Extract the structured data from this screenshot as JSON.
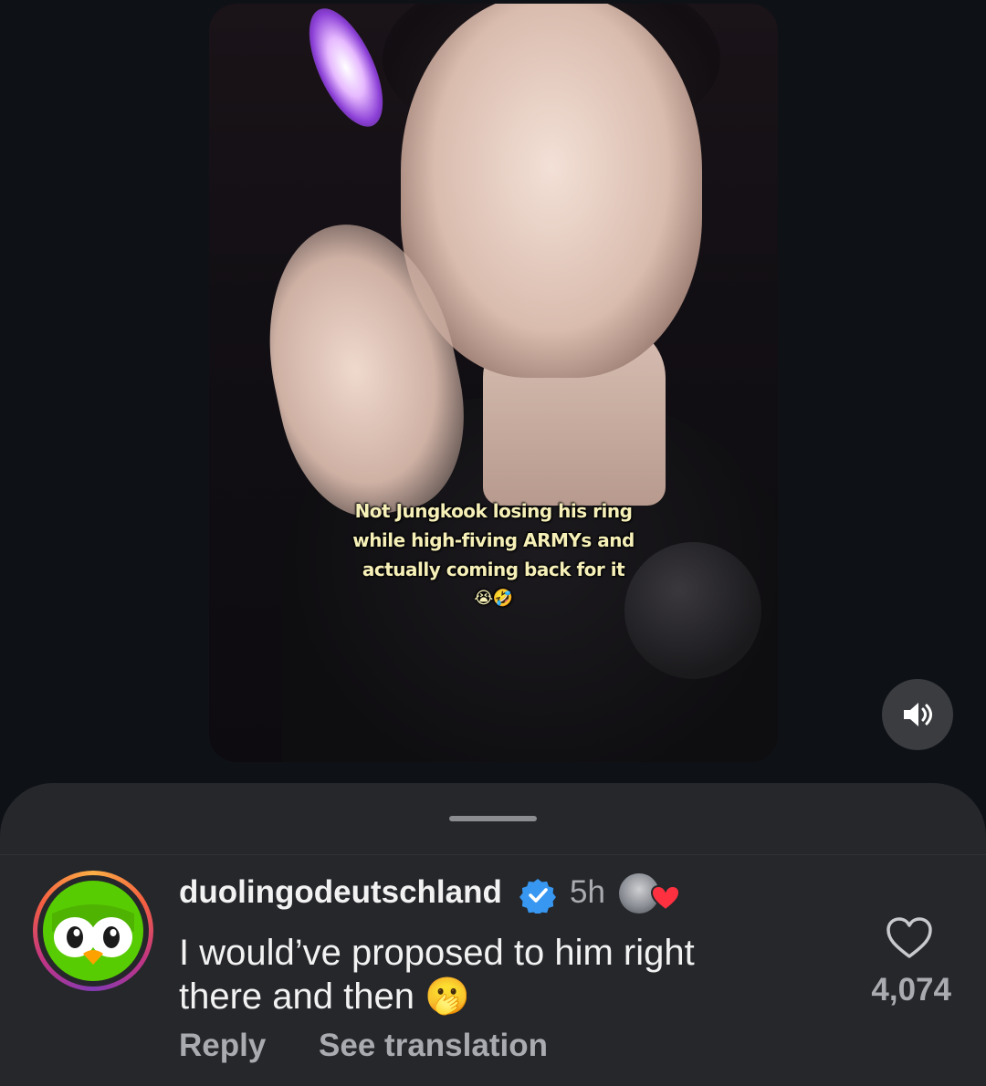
{
  "video": {
    "caption_lines": [
      "Not Jungkook losing his ring",
      "while high-fiving ARMYs and",
      "actually coming back for it",
      "😭🤣"
    ]
  },
  "icons": {
    "sound": "speaker-volume-icon",
    "verified": "verified-badge-icon",
    "like": "heart-outline-icon",
    "liker_heart": "red-heart-icon"
  },
  "comment": {
    "username": "duolingodeutschland",
    "time": "5h",
    "text_line1": "I would’ve proposed to him right",
    "text_line2": "there and then 🫢",
    "reply_label": "Reply",
    "translate_label": "See translation",
    "like_count": "4,074"
  },
  "colors": {
    "background": "#0e1116",
    "sheet": "#25272b",
    "verified_blue": "#3897f0",
    "duolingo_green": "#58cc02",
    "heart_red": "#ff3040"
  }
}
